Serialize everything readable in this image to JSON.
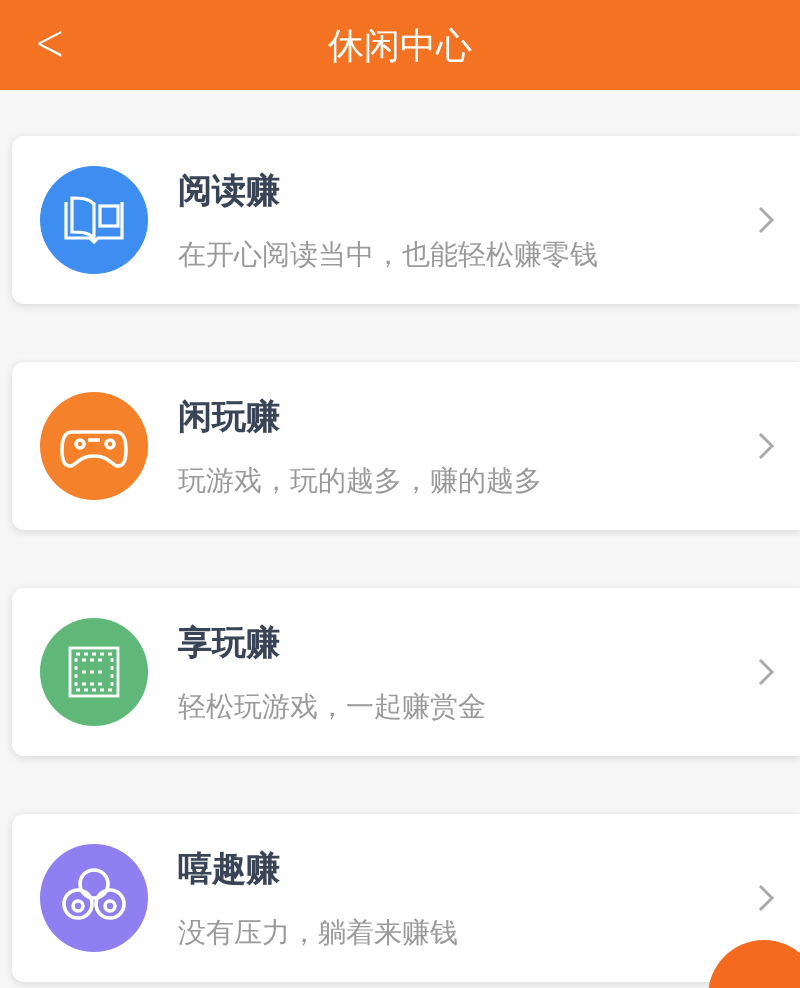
{
  "header": {
    "back": "<",
    "title": "休闲中心"
  },
  "items": [
    {
      "title": "阅读赚",
      "subtitle": "在开心阅读当中，也能轻松赚零钱",
      "kind": "book",
      "color": "#3d8ef0"
    },
    {
      "title": "闲玩赚",
      "subtitle": "玩游戏，玩的越多，赚的越多",
      "kind": "gamepad",
      "color": "#f5812a"
    },
    {
      "title": "享玩赚",
      "subtitle": "轻松玩游戏，一起赚赏金",
      "kind": "grid",
      "color": "#5fb878"
    },
    {
      "title": "嘻趣赚",
      "subtitle": "没有压力，躺着来赚钱",
      "kind": "bubbles",
      "color": "#8f7ff0"
    }
  ]
}
